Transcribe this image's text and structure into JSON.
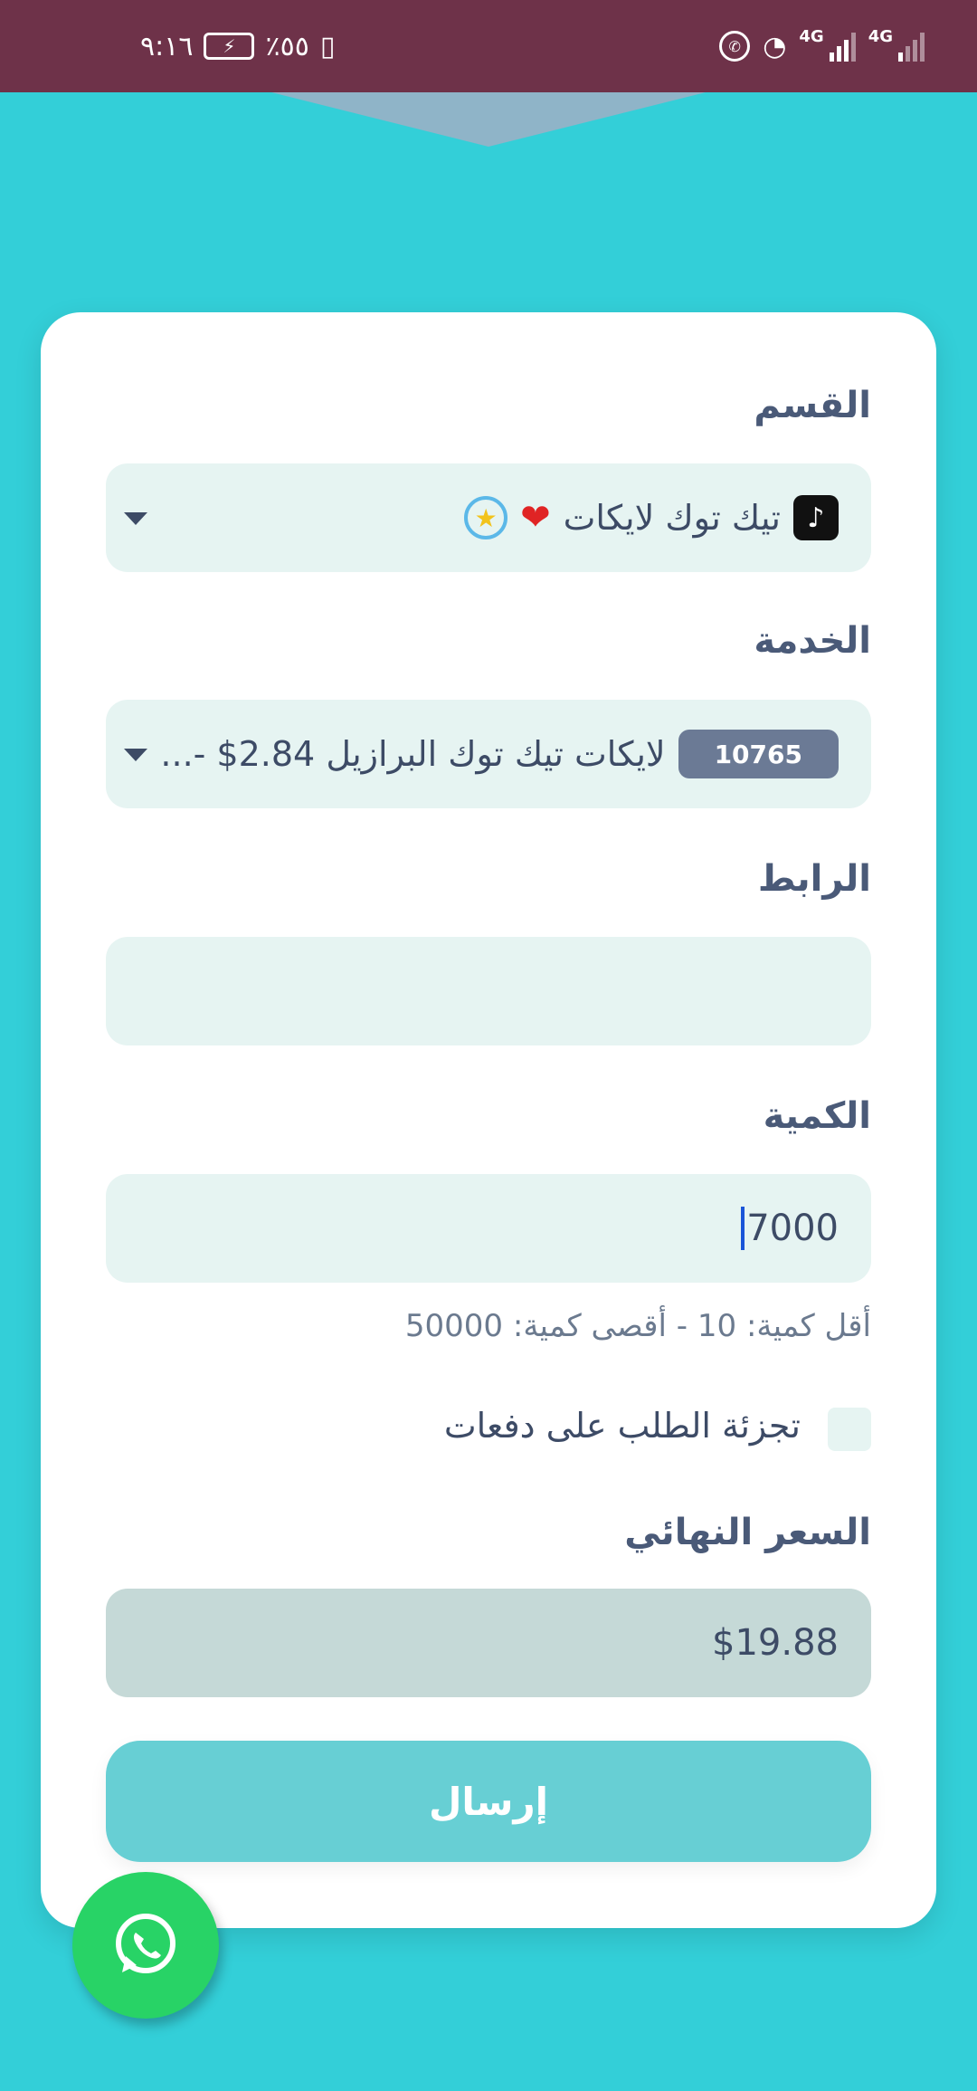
{
  "status_bar": {
    "time": "٩:١٦",
    "battery_percent": "٪٥٥",
    "network_label_1": "4G",
    "network_label_2": "4G"
  },
  "form": {
    "category": {
      "label": "القسم",
      "value": "تيك توك لايكات"
    },
    "service": {
      "label": "الخدمة",
      "id_badge": "10765",
      "value": "لايكات تيك توك البرازيل 2.84$ -..."
    },
    "link": {
      "label": "الرابط",
      "value": ""
    },
    "quantity": {
      "label": "الكمية",
      "value": "7000",
      "hint": "أقل كمية: 10 - أقصى كمية: 50000"
    },
    "drip_feed": {
      "label": "تجزئة الطلب على دفعات",
      "checked": false
    },
    "final_price": {
      "label": "السعر النهائي",
      "value": "$19.88"
    },
    "submit_label": "إرسال"
  },
  "icons": {
    "category_icons": [
      "tiktok-icon",
      "heart-icon",
      "star-icon"
    ],
    "fab": "whatsapp-icon"
  },
  "colors": {
    "status_bar": "#6e3249",
    "background": "#33cfd8",
    "field_bg": "#e6f4f2",
    "price_bg": "#c5d9d7",
    "submit_bg": "#67cfd4",
    "badge_bg": "#6b7a95",
    "whatsapp": "#28d366"
  }
}
